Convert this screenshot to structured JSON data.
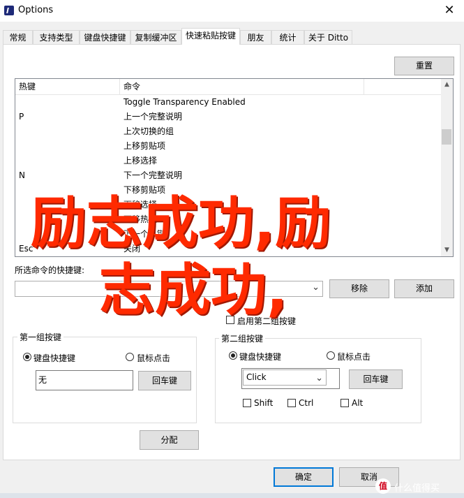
{
  "window": {
    "title": "Options",
    "close_glyph": "✕"
  },
  "tabs": [
    {
      "label": "常规"
    },
    {
      "label": "支持类型"
    },
    {
      "label": "键盘快捷键"
    },
    {
      "label": "复制缓冲区"
    },
    {
      "label": "快速粘贴按键",
      "active": true
    },
    {
      "label": "朋友"
    },
    {
      "label": "统计"
    },
    {
      "label": "关于 Ditto"
    }
  ],
  "reset_button": "重置",
  "list": {
    "headers": {
      "hotkey": "热键",
      "command": "命令"
    },
    "rows": [
      {
        "key": "",
        "cmd": "Toggle Transparency Enabled"
      },
      {
        "key": "P",
        "cmd": "上一个完整说明"
      },
      {
        "key": "",
        "cmd": "上次切换的组"
      },
      {
        "key": "",
        "cmd": "上移剪贴项"
      },
      {
        "key": "",
        "cmd": "上移选择"
      },
      {
        "key": "N",
        "cmd": "下一个完整说明"
      },
      {
        "key": "",
        "cmd": "下移剪贴项"
      },
      {
        "key": "",
        "cmd": "下移选择"
      },
      {
        "key": "",
        "cmd": "下移热键"
      },
      {
        "key": "",
        "cmd": "下一个热键"
      },
      {
        "key": "Esc",
        "cmd": "关闭"
      }
    ],
    "scroll_up": "▲",
    "scroll_down": "▼"
  },
  "selected_hotkey_label": "所选命令的快捷键:",
  "combo_value": "",
  "remove_button": "移除",
  "add_button": "添加",
  "enable_group2_label": "启用第二组按键",
  "group1": {
    "title": "第一组按键",
    "radio_keyboard": "键盘快捷键",
    "radio_mouse": "鼠标点击",
    "key_value": "无",
    "enter_button": "回车键"
  },
  "group2": {
    "title": "第二组按键",
    "radio_keyboard": "键盘快捷键",
    "radio_mouse": "鼠标点击",
    "click_value": "Click",
    "enter_button": "回车键",
    "shift_label": "Shift",
    "ctrl_label": "Ctrl",
    "alt_label": "Alt"
  },
  "assign_button": "分配",
  "ok_button": "确定",
  "cancel_button": "取消",
  "overlay": {
    "line1": "励志成功,励",
    "line2": "志成功,"
  },
  "watermark": {
    "icon": "值",
    "text": "什么值得买"
  },
  "colors": {
    "overlay": "#ff2a00",
    "accent": "#0078d7"
  }
}
